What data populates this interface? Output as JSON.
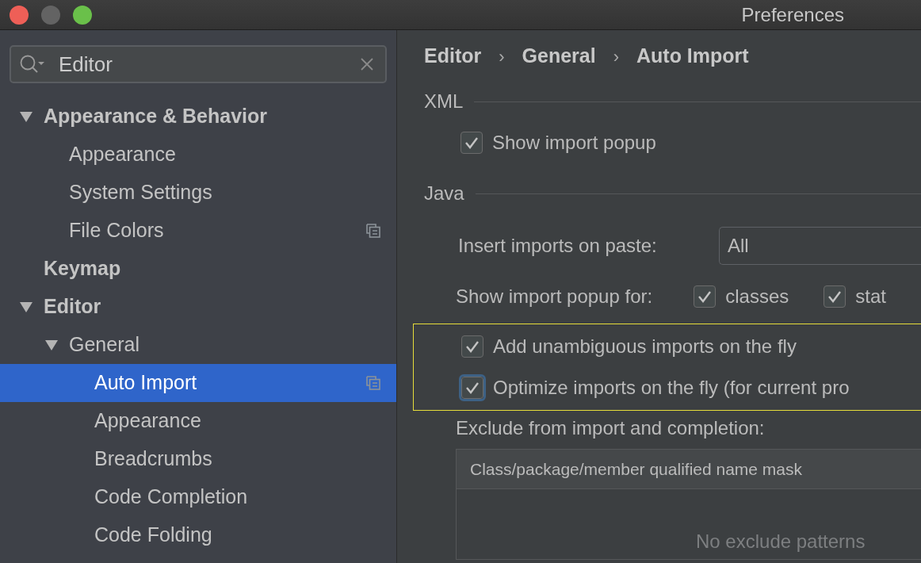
{
  "window": {
    "title": "Preferences"
  },
  "search": {
    "value": "Editor"
  },
  "tree": [
    {
      "label": "Appearance & Behavior",
      "expanded": true,
      "selected": false,
      "project_level": false,
      "children": [
        {
          "label": "Appearance",
          "selected": false,
          "project_level": false
        },
        {
          "label": "System Settings",
          "selected": false,
          "project_level": false
        },
        {
          "label": "File Colors",
          "selected": false,
          "project_level": true
        }
      ]
    },
    {
      "label": "Keymap",
      "selected": false,
      "project_level": false
    },
    {
      "label": "Editor",
      "expanded": true,
      "selected": false,
      "project_level": false,
      "children": [
        {
          "label": "General",
          "expanded": true,
          "selected": false,
          "project_level": false,
          "children": [
            {
              "label": "Auto Import",
              "selected": true,
              "project_level": true
            },
            {
              "label": "Appearance",
              "selected": false,
              "project_level": false
            },
            {
              "label": "Breadcrumbs",
              "selected": false,
              "project_level": false
            },
            {
              "label": "Code Completion",
              "selected": false,
              "project_level": false
            },
            {
              "label": "Code Folding",
              "selected": false,
              "project_level": false
            }
          ]
        }
      ]
    }
  ],
  "breadcrumb": [
    {
      "kind": "crumb",
      "text": "Editor"
    },
    {
      "kind": "separator",
      "text": "›"
    },
    {
      "kind": "crumb",
      "text": "General"
    },
    {
      "kind": "separator",
      "text": "›"
    },
    {
      "kind": "crumb",
      "text": "Auto Import"
    }
  ],
  "sections": [
    {
      "title": "XML",
      "items": [
        {
          "kind": "checkbox",
          "label": "Show import popup",
          "checked": true,
          "focused": false
        }
      ]
    },
    {
      "title": "Java",
      "items": [
        {
          "kind": "select",
          "label": "Insert imports on paste:",
          "value": "All"
        },
        {
          "kind": "checkrow",
          "label": "Show import popup for:",
          "options": [
            {
              "label": "classes",
              "checked": true
            },
            {
              "label": "stat",
              "checked": true
            }
          ]
        },
        {
          "kind": "group",
          "highlighted": true,
          "items": [
            {
              "kind": "checkbox",
              "label": "Add unambiguous imports on the fly",
              "checked": true,
              "focused": false
            },
            {
              "kind": "checkbox",
              "label": "Optimize imports on the fly (for current pro",
              "checked": true,
              "focused": true
            }
          ]
        },
        {
          "kind": "label",
          "label": "Exclude from import and completion:"
        },
        {
          "kind": "table",
          "columns": [
            "Class/package/member qualified name mask"
          ],
          "empty_text": "No exclude patterns"
        }
      ]
    }
  ]
}
